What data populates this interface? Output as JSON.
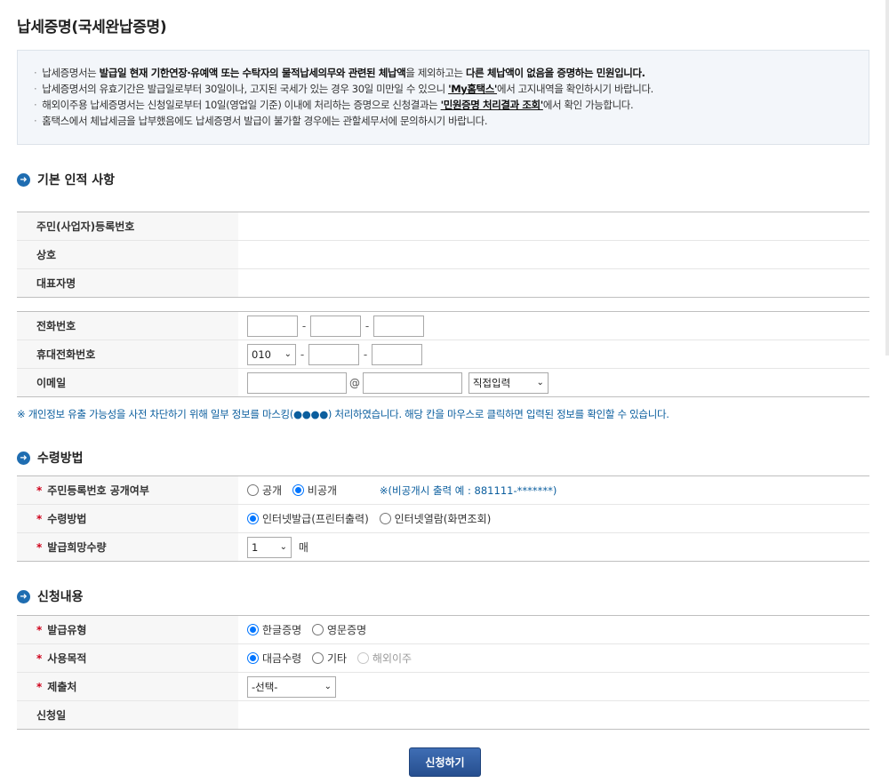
{
  "page": {
    "title": "납세증명(국세완납증명)"
  },
  "notice": {
    "line1_pre": "납세증명서는 ",
    "line1_bold1": "발급일 현재 기한연장·유예액 또는 수탁자의 물적납세의무와 관련된 체납액",
    "line1_mid": "을 제외하고는 ",
    "line1_bold2": "다른 체납액이 없음을 증명하는 민원입니다.",
    "line2_pre": "납세증명서의 유효기간은 발급일로부터 30일이나, 고지된 국세가 있는 경우 30일 미만일 수 있으니 ",
    "line2_link": "'My홈택스'",
    "line2_post": "에서 고지내역을 확인하시기 바랍니다.",
    "line3_pre": "해외이주용 납세증명서는 신청일로부터 10일(영업일 기준) 이내에 처리하는 증명으로 신청결과는 ",
    "line3_link": "'민원증명 처리결과 조회'",
    "line3_post": "에서 확인 가능합니다.",
    "line4": "홈택스에서 체납세금을 납부했음에도 납세증명서 발급이 불가할 경우에는 관할세무서에 문의하시기 바랍니다."
  },
  "basic": {
    "title": "기본 인적 사항",
    "reg_no_label": "주민(사업자)등록번호",
    "reg_no_value": "",
    "company_label": "상호",
    "company_value": "",
    "rep_label": "대표자명",
    "rep_value": "",
    "phone_label": "전화번호",
    "mobile_label": "휴대전화번호",
    "mobile_prefix": "010",
    "email_label": "이메일",
    "email_at": "@",
    "email_domain_select": "직접입력",
    "dash": "-"
  },
  "privacy_note": "※ 개인정보 유출 가능성을 사전 차단하기 위해 일부 정보를 마스킹(●●●●) 처리하였습니다. 해당 칸을 마우스로 클릭하면 입력된 정보를 확인할 수 있습니다.",
  "receive": {
    "title": "수령방법",
    "disclose_label": "주민등록번호 공개여부",
    "disclose_opt1": "공개",
    "disclose_opt2": "비공개",
    "disclose_hint": "※(비공개시 출력 예 : 881111-*******)",
    "method_label": "수령방법",
    "method_opt1": "인터넷발급(프린터출력)",
    "method_opt2": "인터넷열람(화면조회)",
    "qty_label": "발급희망수량",
    "qty_value": "1",
    "qty_unit": "매"
  },
  "apply": {
    "title": "신청내용",
    "type_label": "발급유형",
    "type_opt1": "한글증명",
    "type_opt2": "영문증명",
    "purpose_label": "사용목적",
    "purpose_opt1": "대금수령",
    "purpose_opt2": "기타",
    "purpose_opt3": "해외이주",
    "submit_to_label": "제출처",
    "submit_to_value": "-선택-",
    "date_label": "신청일",
    "date_value": ""
  },
  "submit_button": "신청하기",
  "required_mark": "*",
  "colors": {
    "accent": "#1f6db1",
    "button": "#2f5d9f",
    "radio": "#0075ff",
    "required": "#d0021b",
    "note": "#0b5e9e"
  },
  "icons": {
    "section": "arrow-circle-icon",
    "dropdown": "chevron-down-icon"
  }
}
